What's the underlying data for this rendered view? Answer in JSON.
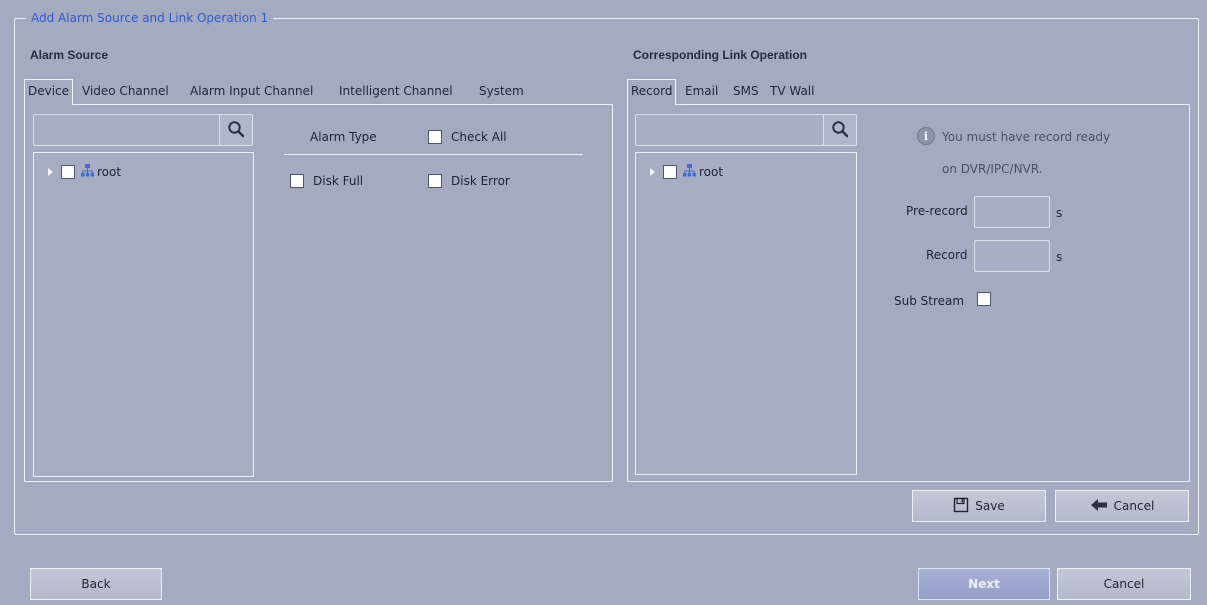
{
  "group_title": "Add Alarm Source and Link Operation  1",
  "alarm_source": {
    "label": "Alarm Source",
    "tabs": [
      "Device",
      "Video Channel",
      "Alarm Input Channel",
      "Intelligent Channel",
      "System"
    ],
    "active_tab": "Device",
    "search_placeholder": "",
    "tree_root": "root",
    "alarm_type_label": "Alarm Type",
    "check_all_label": "Check All",
    "alarm_types": [
      "Disk Full",
      "Disk Error"
    ]
  },
  "link_operation": {
    "label": "Corresponding Link Operation",
    "tabs": [
      "Record",
      "Email",
      "SMS",
      "TV Wall"
    ],
    "active_tab": "Record",
    "search_placeholder": "",
    "tree_root": "root",
    "info_line1": "You must have record ready",
    "info_line2": "on DVR/IPC/NVR.",
    "prerecord_label": "Pre-record",
    "prerecord_value": "",
    "prerecord_unit": "s",
    "record_label": "Record",
    "record_value": "",
    "record_unit": "s",
    "substream_label": "Sub Stream"
  },
  "buttons": {
    "save": "Save",
    "cancel_inner": "Cancel",
    "back": "Back",
    "next": "Next",
    "cancel": "Cancel"
  },
  "icons": {
    "search": "search-icon",
    "tree": "network-tree-icon",
    "info": "info-icon",
    "save": "floppy-disk-icon",
    "cancel": "back-arrow-icon"
  },
  "colors": {
    "background": "#a4abc1",
    "legend_blue": "#2a5ccf",
    "border": "#f0f2f8"
  }
}
